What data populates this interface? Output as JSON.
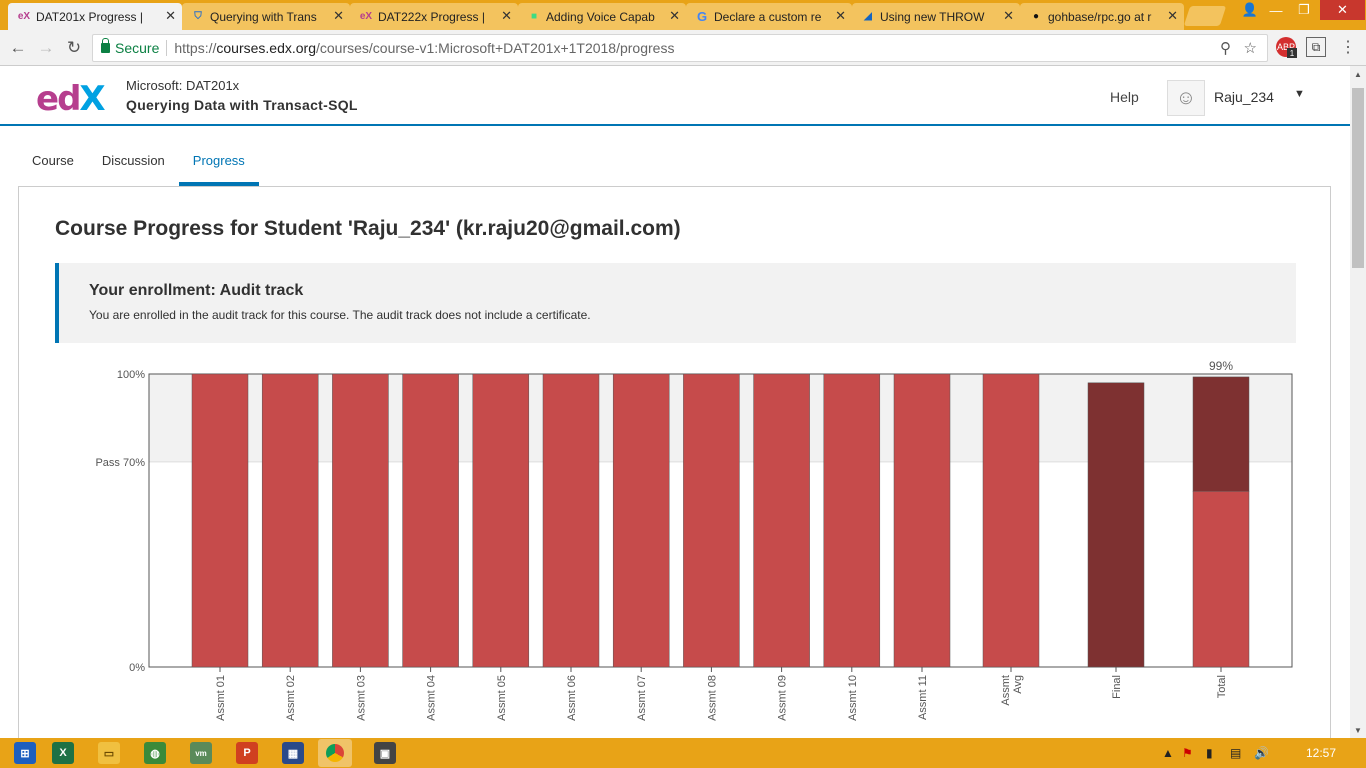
{
  "browser": {
    "tabs": [
      {
        "label": "DAT201x Progress |",
        "icon": "edx-icon",
        "active": true
      },
      {
        "label": "Querying with Trans",
        "icon": "shield-icon",
        "active": false
      },
      {
        "label": "DAT222x Progress |",
        "icon": "edx-icon",
        "active": false
      },
      {
        "label": "Adding Voice Capab",
        "icon": "android-icon",
        "active": false
      },
      {
        "label": "Declare a custom re",
        "icon": "google-icon",
        "active": false
      },
      {
        "label": "Using new THROW",
        "icon": "blog-icon",
        "active": false
      },
      {
        "label": "gohbase/rpc.go at r",
        "icon": "github-icon",
        "active": false
      }
    ],
    "secure_label": "Secure",
    "url_prefix": "https://",
    "url_host": "courses.edx.org",
    "url_path": "/courses/course-v1:Microsoft+DAT201x+1T2018/progress",
    "extension_badge": "1"
  },
  "header": {
    "course_org": "Microsoft: DAT201x",
    "course_title": "Querying Data with Transact-SQL",
    "help": "Help",
    "username": "Raju_234"
  },
  "course_tabs": [
    {
      "label": "Course",
      "active": false
    },
    {
      "label": "Discussion",
      "active": false
    },
    {
      "label": "Progress",
      "active": true
    }
  ],
  "main": {
    "title": "Course Progress for Student 'Raju_234' (kr.raju20@gmail.com)",
    "enrollment_heading": "Your enrollment: Audit track",
    "enrollment_text": "You are enrolled in the audit track for this course. The audit track does not include a certificate."
  },
  "chart_data": {
    "type": "bar",
    "categories": [
      "Assmt 01",
      "Assmt 02",
      "Assmt 03",
      "Assmt 04",
      "Assmt 05",
      "Assmt 06",
      "Assmt 07",
      "Assmt 08",
      "Assmt 09",
      "Assmt 10",
      "Assmt 11",
      "Assmt Avg",
      "Final",
      "Total"
    ],
    "values": [
      100,
      100,
      100,
      100,
      100,
      100,
      100,
      100,
      100,
      100,
      100,
      100,
      97,
      99
    ],
    "total_stack": {
      "lower": 60,
      "upper": 39
    },
    "total_label": "99%",
    "y_ticks": [
      {
        "value": 100,
        "label": "100%"
      },
      {
        "value": 70,
        "label": "Pass 70%"
      },
      {
        "value": 0,
        "label": "0%"
      }
    ],
    "ylim": [
      0,
      100
    ],
    "pass_threshold": 70,
    "colors": {
      "assignment": "#c64b4b",
      "final": "#7e3131",
      "total_upper": "#7e3131",
      "total_lower": "#c64b4b",
      "pass_band": "#f2f2f2"
    }
  },
  "taskbar": {
    "clock": "12:57"
  }
}
